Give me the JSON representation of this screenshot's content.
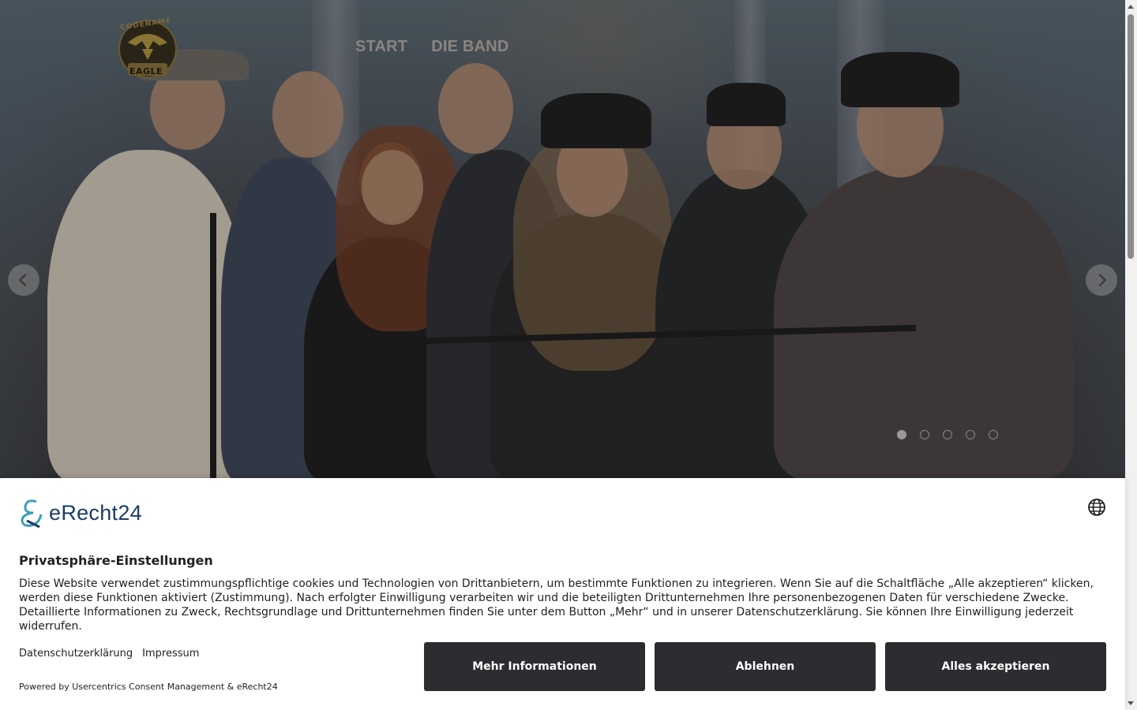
{
  "nav": {
    "items": [
      {
        "label": "START"
      },
      {
        "label": "DIE BAND"
      }
    ]
  },
  "logo": {
    "top_text": "CODENAME",
    "bottom_text": "EAGLE"
  },
  "slider": {
    "slide_count": 5,
    "active_index": 0
  },
  "consent": {
    "brand": "eRecht24",
    "title": "Privatsphäre-Einstellungen",
    "body": "Diese Website verwendet zustimmungspflichtige cookies und Technologien von Drittanbietern, um bestimmte Funktionen zu integrieren. Wenn Sie auf die Schaltfläche „Alle akzeptieren“ klicken, werden diese Funktionen aktiviert (Zustimmung). Nach erfolgter Einwilligung verarbeiten wir und die beteiligten Drittunternehmen Ihre personenbezogenen Daten für verschiedene Zwecke. Detaillierte Informationen zu Zweck, Rechtsgrundlage und Drittunternehmen finden Sie unter dem Button „Mehr“ und in unserer Datenschutzerklärung. Sie können Ihre Einwilligung jederzeit widerrufen.",
    "link_privacy": "Datenschutzerklärung",
    "link_imprint": "Impressum",
    "powered": "Powered by Usercentrics Consent Management & eRecht24",
    "btn_more": "Mehr Informationen",
    "btn_deny": "Ablehnen",
    "btn_accept": "Alles akzeptieren"
  },
  "colors": {
    "button_bg": "#2b2d31",
    "brand": "#1a3d66",
    "brand_accent": "#3aa0b8"
  }
}
